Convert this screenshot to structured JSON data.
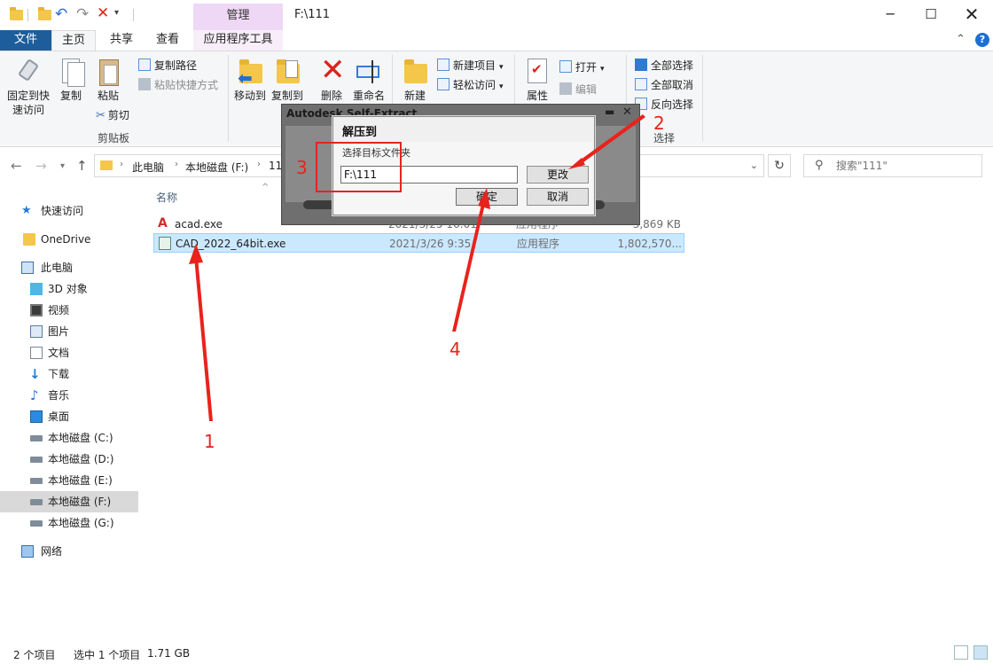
{
  "window": {
    "title": "F:\\111",
    "manage_tab": "管理",
    "controls": {
      "minimize": "─",
      "maximize": "☐",
      "close": "✕"
    }
  },
  "ribbon_tabs": {
    "file": "文件",
    "home": "主页",
    "share": "共享",
    "view": "查看",
    "app_tools": "应用程序工具"
  },
  "ribbon": {
    "pin": "固定到快速访问",
    "pin_line1": "固定到快",
    "pin_line2": "速访问",
    "copy": "复制",
    "paste": "粘贴",
    "copy_path": "复制路径",
    "paste_shortcut": "粘贴快捷方式",
    "cut": "剪切",
    "clipboard_group": "剪贴板",
    "move_to": "移动到",
    "copy_to": "复制到",
    "delete": "删除",
    "rename": "重命名",
    "new_folder": "新建",
    "new_item": "新建项目",
    "easy_access": "轻松访问",
    "properties": "属性",
    "open": "打开",
    "edit": "编辑",
    "select_all": "全部选择",
    "select_none": "全部取消",
    "invert_selection": "反向选择",
    "select_group": "选择"
  },
  "address": {
    "crumbs": [
      "此电脑",
      "本地磁盘 (F:)",
      "11"
    ],
    "search_placeholder": "搜索\"111\""
  },
  "sidebar": {
    "items": [
      {
        "label": "快速访问",
        "icon": "star-icon"
      },
      {
        "label": "OneDrive",
        "icon": "folder-icon"
      },
      {
        "label": "此电脑",
        "icon": "computer-icon"
      },
      {
        "label": "3D 对象",
        "icon": "cube-icon"
      },
      {
        "label": "视频",
        "icon": "video-icon"
      },
      {
        "label": "图片",
        "icon": "picture-icon"
      },
      {
        "label": "文档",
        "icon": "document-icon"
      },
      {
        "label": "下载",
        "icon": "download-icon"
      },
      {
        "label": "音乐",
        "icon": "music-icon"
      },
      {
        "label": "桌面",
        "icon": "desktop-icon"
      },
      {
        "label": "本地磁盘 (C:)",
        "icon": "drive-icon"
      },
      {
        "label": "本地磁盘 (D:)",
        "icon": "drive-icon"
      },
      {
        "label": "本地磁盘 (E:)",
        "icon": "drive-icon"
      },
      {
        "label": "本地磁盘 (F:)",
        "icon": "drive-icon"
      },
      {
        "label": "本地磁盘 (G:)",
        "icon": "drive-icon"
      },
      {
        "label": "网络",
        "icon": "network-icon"
      }
    ]
  },
  "files": {
    "column_name": "名称",
    "rows": [
      {
        "name": "acad.exe",
        "date": "2021/3/25 16:01",
        "type": "应用程序",
        "size": "3,869 KB"
      },
      {
        "name": "CAD_2022_64bit.exe",
        "date": "2021/3/26 9:35",
        "type": "应用程序",
        "size": "1,802,570..."
      }
    ]
  },
  "status": {
    "count": "2 个项目",
    "selected": "选中 1 个项目",
    "size": "1.71 GB"
  },
  "extract_dialog": {
    "outer_title": "Autodesk Self-Extract",
    "title": "解压到",
    "hint": "选择目标文件夹",
    "path_value": "F:\\111",
    "change": "更改",
    "ok": "确定",
    "cancel": "取消"
  },
  "annotations": {
    "n1": "1",
    "n2": "2",
    "n3": "3",
    "n4": "4",
    "color": "#e8231c"
  }
}
